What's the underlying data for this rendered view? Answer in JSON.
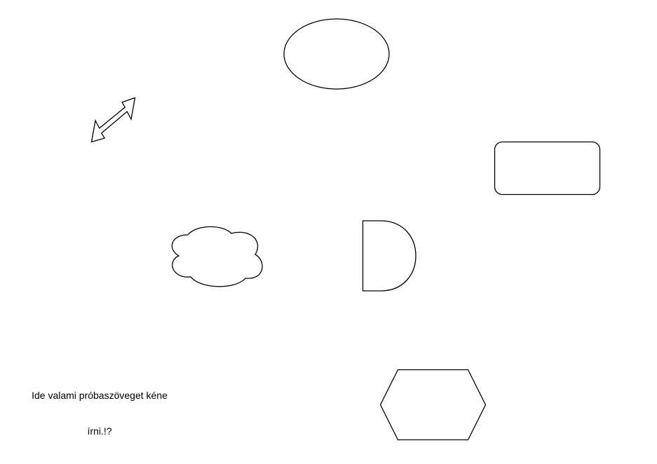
{
  "diagram": {
    "shapes": [
      {
        "name": "ellipse-shape",
        "type": "ellipse"
      },
      {
        "name": "double-arrow-shape",
        "type": "bidirectional-arrow"
      },
      {
        "name": "rounded-rectangle-shape",
        "type": "rounded-rectangle"
      },
      {
        "name": "cloud-shape",
        "type": "cloud"
      },
      {
        "name": "delay-shape",
        "type": "delay"
      },
      {
        "name": "hexagon-shape",
        "type": "hexagon"
      }
    ],
    "text_label": {
      "line1": "Ide valami próbaszöveget kéne",
      "line2": "írni.!?"
    },
    "colors": {
      "stroke": "#000000",
      "fill": "#ffffff",
      "background": "#ffffff"
    }
  }
}
